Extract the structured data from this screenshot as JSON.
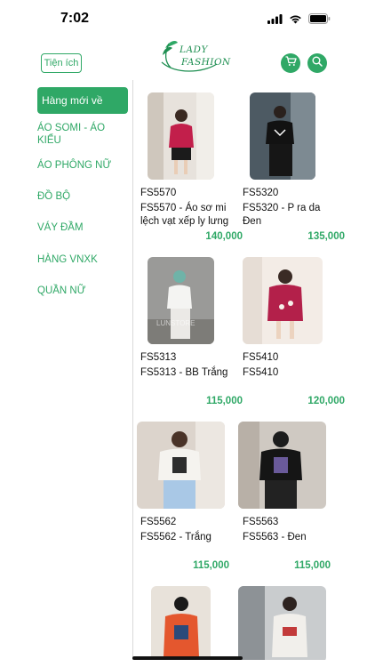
{
  "status": {
    "time": "7:02"
  },
  "header": {
    "utility_label": "Tiện ích",
    "logo_line1": "LADY",
    "logo_line2": "FASHION"
  },
  "colors": {
    "accent": "#2fa866",
    "divider": "#d9d9d9"
  },
  "categories": [
    {
      "label": "Hàng mới về",
      "active": true
    },
    {
      "label": "ÁO SOMI - ÁO KIỂU",
      "active": false
    },
    {
      "label": "ÁO PHÔNG NỮ",
      "active": false
    },
    {
      "label": "ĐỒ BỘ",
      "active": false
    },
    {
      "label": "VÁY ĐẦM",
      "active": false
    },
    {
      "label": "HÀNG VNXK",
      "active": false
    },
    {
      "label": "QUẦN NỮ",
      "active": false
    }
  ],
  "products": [
    {
      "code": "FS5570",
      "name": "FS5570 - Áo sơ mi lệch vạt xếp ly lưng",
      "price": "140,000"
    },
    {
      "code": "FS5320",
      "name": "FS5320 - P ra da Đen",
      "price": "135,000"
    },
    {
      "code": "FS5313",
      "name": "FS5313 - BB Trắng",
      "price": "115,000",
      "watermark": "LUNSTORE"
    },
    {
      "code": "FS5410",
      "name": "FS5410",
      "price": "120,000"
    },
    {
      "code": "FS5562",
      "name": "FS5562 - Trắng",
      "price": "115,000"
    },
    {
      "code": "FS5563",
      "name": "FS5563 - Đen",
      "price": "115,000"
    },
    {
      "code": "",
      "name": "",
      "price": ""
    },
    {
      "code": "",
      "name": "",
      "price": ""
    }
  ]
}
